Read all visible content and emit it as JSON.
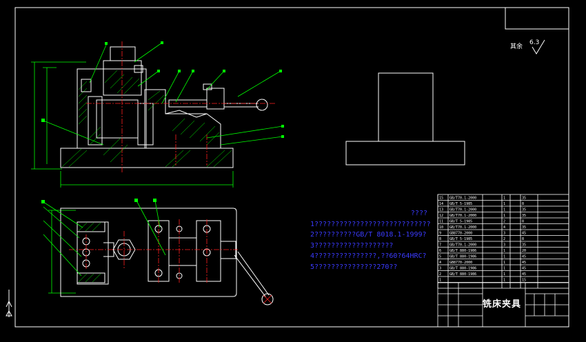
{
  "drawing_title": "铣床夹具",
  "roughness": {
    "label": "其余",
    "value": "6.3"
  },
  "notes": {
    "heading": "????",
    "lines": [
      "1????????????????????????????",
      "2??????????GB/T 8018.1-1999?",
      "3???????????????????",
      "4???????????????,??60?64HRC?",
      "5???????????????270??"
    ]
  },
  "colors": {
    "background": "#000000",
    "frame": "#ffffff",
    "geometry": "#ffffff",
    "hatch": "#00ff00",
    "centerline": "#ff2020",
    "leader": "#00ff00",
    "notes": "#3b3bff",
    "dim": "#00ff00"
  },
  "bom_rows": [
    {
      "no": "15",
      "code": "GB/T70.1-2000",
      "name": "",
      "qty": "1",
      "mat": "35"
    },
    {
      "no": "14",
      "code": "GB/T 5-1985",
      "name": "",
      "qty": "1",
      "mat": "8"
    },
    {
      "no": "13",
      "code": "GB/T70.1-2000",
      "name": "",
      "qty": "1",
      "mat": "35"
    },
    {
      "no": "12",
      "code": "GB/T70.1-2000",
      "name": "",
      "qty": "1",
      "mat": "35"
    },
    {
      "no": "11",
      "code": "GB/T 5-1985",
      "name": "",
      "qty": "2",
      "mat": "8"
    },
    {
      "no": "10",
      "code": "GB/T70.1-2000",
      "name": "",
      "qty": "4",
      "mat": "35"
    },
    {
      "no": "9",
      "code": "GB8770-2000",
      "name": "",
      "qty": "3",
      "mat": "45"
    },
    {
      "no": "8",
      "code": "GB/T 5-1985",
      "name": "",
      "qty": "2",
      "mat": "8"
    },
    {
      "no": "7",
      "code": "GB/T70.1-2000",
      "name": "",
      "qty": "3",
      "mat": "35"
    },
    {
      "no": "6",
      "code": "GB/T 880-1986",
      "name": "",
      "qty": "1",
      "mat": "20"
    },
    {
      "no": "5",
      "code": "GB/T 880-1986",
      "name": "",
      "qty": "1",
      "mat": "45"
    },
    {
      "no": "4",
      "code": "GB8770-2000",
      "name": "",
      "qty": "1",
      "mat": "45"
    },
    {
      "no": "3",
      "code": "GB/T 880-1986",
      "name": "",
      "qty": "1",
      "mat": "45"
    },
    {
      "no": "2",
      "code": "GB/T 880-1986",
      "name": "",
      "qty": "1",
      "mat": "45"
    },
    {
      "no": "1",
      "code": "",
      "name": "",
      "qty": "1",
      "mat": "15"
    }
  ]
}
